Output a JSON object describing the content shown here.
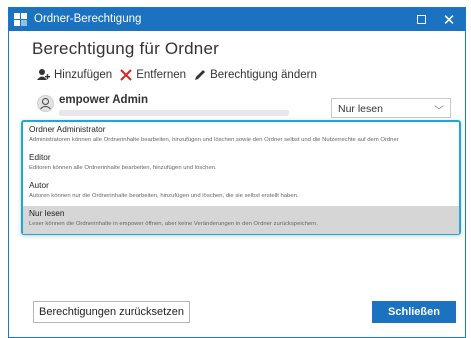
{
  "window": {
    "title": "Ordner-Berechtigung",
    "heading": "Berechtigung für Ordner"
  },
  "toolbar": {
    "add_label": "Hinzufügen",
    "remove_label": "Entfernen",
    "change_label": "Berechtigung ändern"
  },
  "user": {
    "name": "empower Admin",
    "role": "Nur lesen"
  },
  "dropdown": {
    "options": [
      {
        "name": "Ordner Administrator",
        "description": "Administratoren können alle Ordnerinhalte bearbeiten, hinzufügen und löschen sowie den Ordner selbst und die Nutzerrechte auf dem Ordner"
      },
      {
        "name": "Editor",
        "description": "Editoren können alle Ordnerinhalte bearbeiten, hinzufügen und löschen."
      },
      {
        "name": "Autor",
        "description": "Autoren können nur die Ordnerinhalte bearbeiten, hinzufügen und löschen, die sie selbst erstellt haben."
      },
      {
        "name": "Nur lesen",
        "description": "Leser können die Ordnerinhalte in empower öffnen, aber keine Veränderungen in den Ordner zurückspeichern."
      }
    ],
    "selected_index": 3
  },
  "footer": {
    "reset_label": "Berechtigungen zurücksetzen",
    "close_label": "Schließen"
  },
  "colors": {
    "accent": "#1b72c0",
    "dropdown_border": "#19a9d8",
    "remove_icon": "#e02020"
  }
}
